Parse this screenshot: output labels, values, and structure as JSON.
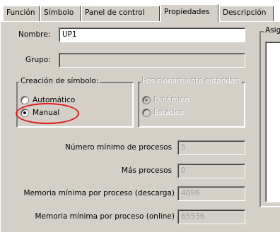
{
  "tabs": [
    {
      "label": "Función",
      "active": false
    },
    {
      "label": "Símbolo",
      "active": false
    },
    {
      "label": "Panel de control",
      "active": false
    },
    {
      "label": "Propiedades",
      "active": true
    },
    {
      "label": "Descripción",
      "active": false
    }
  ],
  "form": {
    "nombre_label": "Nombre:",
    "nombre_value": "UP1",
    "grupo_label": "Grupo:",
    "grupo_value": ""
  },
  "symbol_creation": {
    "title": "Creación de símbolo:",
    "options": [
      {
        "label": "Automático",
        "selected": false
      },
      {
        "label": "Manual",
        "selected": true
      }
    ]
  },
  "standard_positioning": {
    "title": "Posicionamiento estándar:",
    "enabled": false,
    "options": [
      {
        "label": "Dinámico",
        "selected": true
      },
      {
        "label": "Estático",
        "selected": false
      }
    ]
  },
  "processes": {
    "min_label": "Número mínimo de procesos",
    "min_value": "5",
    "more_label": "Más procesos",
    "more_value": "0",
    "mem_download_label": "Memoria mínima por proceso (descarga)",
    "mem_download_value": "4096",
    "mem_online_label": "Memoria mínima por proceso (online)",
    "mem_online_value": "65536"
  },
  "assign_group": {
    "title": "Asig"
  },
  "colors": {
    "dialog_face": "#d4d0c8",
    "highlight_ring": "#e01a1a"
  }
}
